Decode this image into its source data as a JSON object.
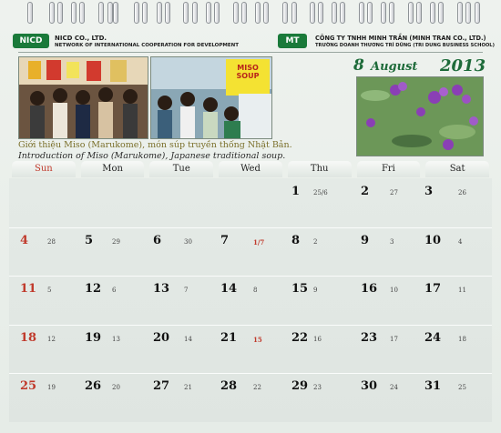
{
  "header": {
    "left_logo_text": "NICD",
    "left_org_name": "NICD CO., LTD.",
    "left_org_sub": "NETWORK OF INTERNATIONAL COOPERATION FOR DEVELOPMENT",
    "right_logo_text": "MT",
    "right_org_name": "CÔNG TY TNHH MINH TRẦN (MINH TRAN CO., LTD.)",
    "right_org_sub": "TRƯỜNG DOANH THƯƠNG TRÍ DŨNG (TRI DUNG BUSINESS SCHOOL)",
    "accent_color": "#1e6b3a"
  },
  "date": {
    "day": "8",
    "month": "August",
    "year": "2013"
  },
  "captions": {
    "vi": "Giới thiệu Miso (Marukome), món súp truyền thống Nhật Bản.",
    "en": "Introduction of Miso (Marukome), Japanese traditional soup."
  },
  "photos": {
    "photo1": "event photo",
    "photo2_sign": "MISO SOUP",
    "photo3": "purple flowers"
  },
  "weekdays": [
    "Sun",
    "Mon",
    "Tue",
    "Wed",
    "Thu",
    "Fri",
    "Sat"
  ],
  "weeks": [
    [
      null,
      null,
      null,
      null,
      {
        "d": "1",
        "l": "25/6"
      },
      {
        "d": "2",
        "l": "27"
      },
      {
        "d": "3",
        "l": "26"
      }
    ],
    [
      {
        "d": "4",
        "l": "28"
      },
      {
        "d": "5",
        "l": "29"
      },
      {
        "d": "6",
        "l": "30"
      },
      {
        "d": "7",
        "l": "1/7"
      },
      {
        "d": "8",
        "l": "2"
      },
      {
        "d": "9",
        "l": "3"
      },
      {
        "d": "10",
        "l": "4"
      }
    ],
    [
      {
        "d": "11",
        "l": "5"
      },
      {
        "d": "12",
        "l": "6"
      },
      {
        "d": "13",
        "l": "7"
      },
      {
        "d": "14",
        "l": "8"
      },
      {
        "d": "15",
        "l": "9"
      },
      {
        "d": "16",
        "l": "10"
      },
      {
        "d": "17",
        "l": "11"
      }
    ],
    [
      {
        "d": "18",
        "l": "12"
      },
      {
        "d": "19",
        "l": "13"
      },
      {
        "d": "20",
        "l": "14"
      },
      {
        "d": "21",
        "l": "15"
      },
      {
        "d": "22",
        "l": "16"
      },
      {
        "d": "23",
        "l": "17"
      },
      {
        "d": "24",
        "l": "18"
      }
    ],
    [
      {
        "d": "25",
        "l": "19"
      },
      {
        "d": "26",
        "l": "20"
      },
      {
        "d": "27",
        "l": "21"
      },
      {
        "d": "28",
        "l": "22"
      },
      {
        "d": "29",
        "l": "23"
      },
      {
        "d": "30",
        "l": "24"
      },
      {
        "d": "31",
        "l": "25"
      }
    ]
  ]
}
